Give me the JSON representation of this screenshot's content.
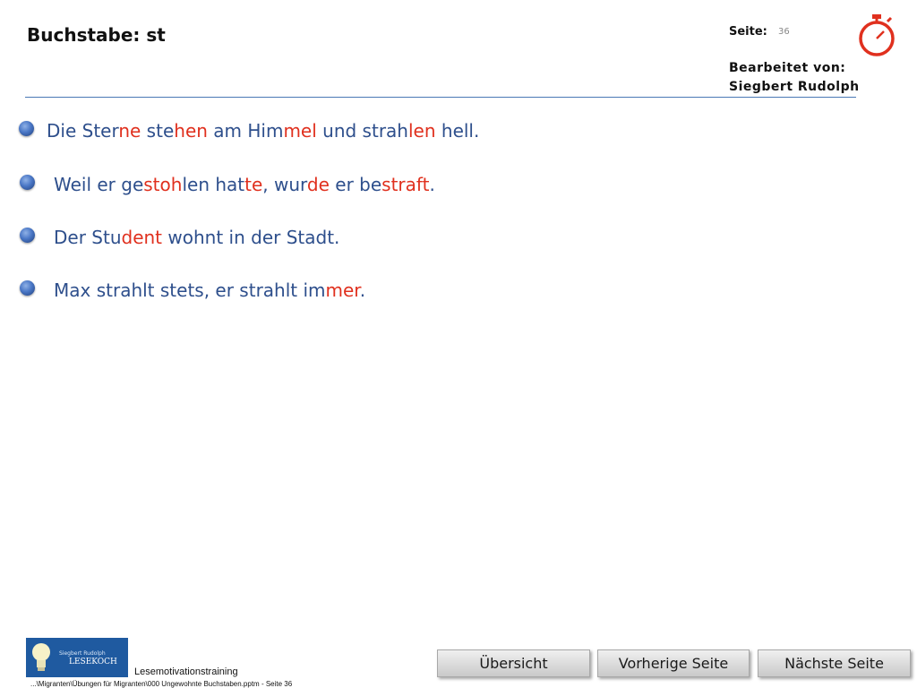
{
  "header": {
    "title": "Buchstabe: st",
    "page_label": "Seite:",
    "page_number": "36",
    "edited_by_label": "Bearbeitet von:",
    "author": "Siegbert Rudolph",
    "timer_icon": "stopwatch-icon"
  },
  "colors": {
    "text_blue": "#2e4f8c",
    "highlight_red": "#e0301e",
    "rule_blue": "#4a78b5"
  },
  "sentences": [
    [
      {
        "t": "Die Ster",
        "hl": false
      },
      {
        "t": "ne",
        "hl": true
      },
      {
        "t": " ste",
        "hl": false
      },
      {
        "t": "hen",
        "hl": true
      },
      {
        "t": " am Him",
        "hl": false
      },
      {
        "t": "mel",
        "hl": true
      },
      {
        "t": " und strah",
        "hl": false
      },
      {
        "t": "len",
        "hl": true
      },
      {
        "t": " hell.",
        "hl": false
      }
    ],
    [
      {
        "t": "Weil er ge",
        "hl": false
      },
      {
        "t": "stoh",
        "hl": true
      },
      {
        "t": "len hat",
        "hl": false
      },
      {
        "t": "te",
        "hl": true
      },
      {
        "t": ", wur",
        "hl": false
      },
      {
        "t": "de",
        "hl": true
      },
      {
        "t": " er be",
        "hl": false
      },
      {
        "t": "straft",
        "hl": true
      },
      {
        "t": ".",
        "hl": false
      }
    ],
    [
      {
        "t": "Der Stu",
        "hl": false
      },
      {
        "t": "dent",
        "hl": true
      },
      {
        "t": " wohnt in der Stadt.",
        "hl": false
      }
    ],
    [
      {
        "t": "Max strahlt stets, er strahlt im",
        "hl": false
      },
      {
        "t": "mer",
        "hl": true
      },
      {
        "t": ".",
        "hl": false
      }
    ]
  ],
  "footer": {
    "logo_name": "Siegbert Rudolph",
    "logo_brand": "LESEKOCH",
    "title": "Lesemotivationstraining",
    "path": "...\\Migranten\\Übungen für Migranten\\000 Ungewohnte Buchstaben.pptm - Seite 36"
  },
  "nav": {
    "overview": "Übersicht",
    "previous": "Vorherige Seite",
    "next": "Nächste Seite"
  }
}
